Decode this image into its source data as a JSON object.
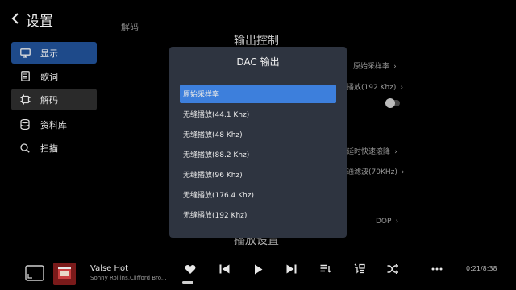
{
  "header": {
    "back_icon": "chevron-left-icon",
    "title": "设置"
  },
  "sidebar": {
    "items": [
      {
        "label": "显示",
        "icon": "monitor-icon",
        "state": "active"
      },
      {
        "label": "歌词",
        "icon": "document-icon",
        "state": "normal"
      },
      {
        "label": "解码",
        "icon": "chip-icon",
        "state": "hover"
      },
      {
        "label": "资料库",
        "icon": "database-icon",
        "state": "normal"
      },
      {
        "label": "扫描",
        "icon": "search-icon",
        "state": "normal"
      }
    ]
  },
  "content": {
    "section_label": "解码",
    "heading_output": "输出控制",
    "heading_playback": "播放设置",
    "rows": [
      {
        "value": "原始采样率"
      },
      {
        "value": "播放(192 Khz)"
      },
      {
        "value": "延时快速滚降"
      },
      {
        "value": "通滤波(70KHz)"
      },
      {
        "value": "DOP"
      }
    ]
  },
  "dialog": {
    "title": "DAC 输出",
    "options": [
      "原始采样率",
      "无缝播放(44.1 Khz)",
      "无缝播放(48 Khz)",
      "无缝播放(88.2 Khz)",
      "无缝播放(96 Khz)",
      "无缝播放(176.4 Khz)",
      "无缝播放(192 Khz)"
    ],
    "selected_index": 0
  },
  "player": {
    "song_title": "Valse Hot",
    "artist": "Sonny Rollins,Clifford Bro...",
    "time": "0:21/8:38",
    "progress_fraction": 0.04
  },
  "colors": {
    "accent": "#3d7fdc",
    "sidebar_active": "#1e4a8a",
    "dialog_bg": "#2e3440"
  }
}
